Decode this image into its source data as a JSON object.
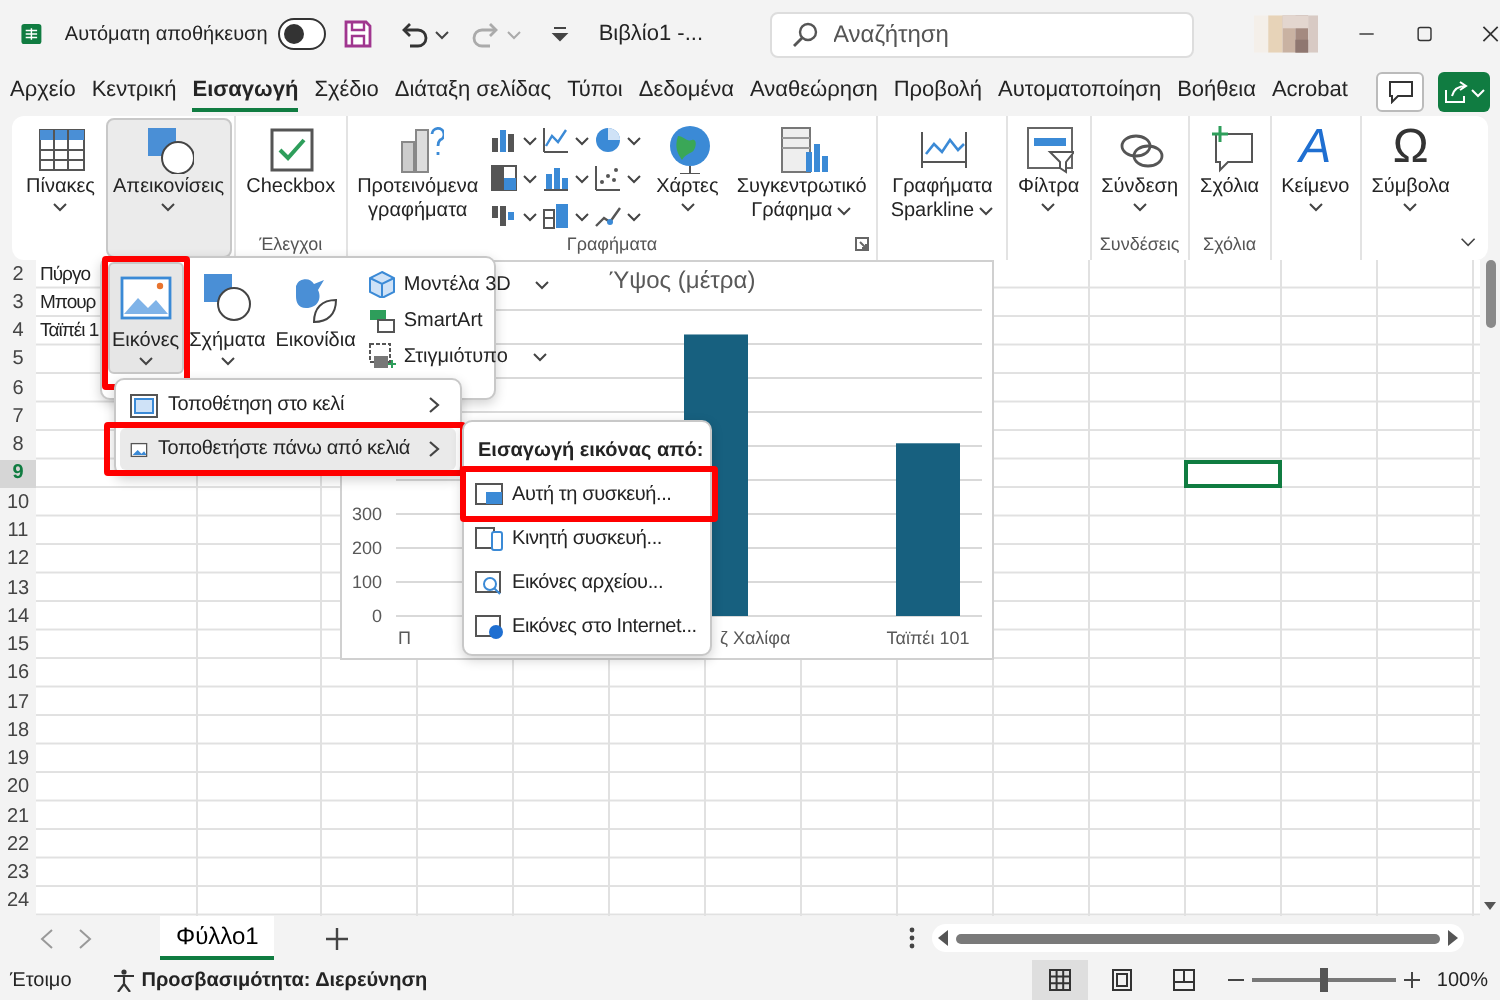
{
  "title_bar": {
    "autosave_label": "Αυτόματη αποθήκευση",
    "autosave_on": false,
    "document_title": "Βιβλίο1 -...",
    "search": {
      "placeholder": "Αναζήτηση"
    }
  },
  "menu_tabs": [
    {
      "label": "Αρχείο",
      "selected": false
    },
    {
      "label": "Κεντρική",
      "selected": false
    },
    {
      "label": "Εισαγωγή",
      "selected": true
    },
    {
      "label": "Σχέδιο",
      "selected": false
    },
    {
      "label": "Διάταξη σελίδας",
      "selected": false
    },
    {
      "label": "Τύποι",
      "selected": false
    },
    {
      "label": "Δεδομένα",
      "selected": false
    },
    {
      "label": "Αναθεώρηση",
      "selected": false
    },
    {
      "label": "Προβολή",
      "selected": false
    },
    {
      "label": "Αυτοματοποίηση",
      "selected": false
    },
    {
      "label": "Βοήθεια",
      "selected": false
    },
    {
      "label": "Acrobat",
      "selected": false
    }
  ],
  "ribbon": {
    "groups": [
      {
        "launcher": false,
        "buttons": [
          {
            "kind": "large",
            "label": "Πίνακες",
            "dropdown": true,
            "pressed": false
          },
          {
            "kind": "large",
            "label": "Απεικονίσεις",
            "dropdown": true,
            "pressed": true
          }
        ]
      },
      {
        "label": "Έλεγχοι",
        "launcher": false,
        "buttons": [
          {
            "kind": "large",
            "label": "Checkbox",
            "dropdown": false,
            "pressed": false
          }
        ]
      },
      {
        "label": "Γραφήματα",
        "launcher": true,
        "buttons": [
          {
            "kind": "large",
            "label": "Προτεινόμενα γραφήματα",
            "dropdown": false,
            "pressed": false
          },
          {
            "kind": "icon_grid"
          },
          {
            "kind": "large",
            "label": "Χάρτες",
            "dropdown": true,
            "pressed": false
          },
          {
            "kind": "large",
            "label": "Συγκεντρωτικό Γράφημα",
            "dropdown": true,
            "pressed": false
          }
        ]
      },
      {
        "launcher": false,
        "buttons": [
          {
            "kind": "large",
            "label": "Γραφήματα Sparkline",
            "dropdown": true,
            "pressed": false
          }
        ]
      },
      {
        "launcher": false,
        "buttons": [
          {
            "kind": "large",
            "label": "Φίλτρα",
            "dropdown": true,
            "pressed": false
          }
        ]
      },
      {
        "label": "Συνδέσεις",
        "launcher": false,
        "buttons": [
          {
            "kind": "large",
            "label": "Σύνδεση",
            "dropdown": true,
            "pressed": false
          }
        ]
      },
      {
        "label": "Σχόλια",
        "launcher": false,
        "buttons": [
          {
            "kind": "large",
            "label": "Σχόλια",
            "dropdown": false,
            "pressed": false
          }
        ]
      },
      {
        "launcher": false,
        "buttons": [
          {
            "kind": "large",
            "label": "Κείμενο",
            "glyph": "A",
            "dropdown": true,
            "pressed": false
          }
        ]
      },
      {
        "launcher": false,
        "buttons": [
          {
            "kind": "large",
            "label": "Σύμβολα",
            "glyph": "Ω",
            "dropdown": true,
            "pressed": false
          }
        ]
      }
    ]
  },
  "illustrations_gallery": {
    "large": [
      {
        "label": "Εικόνες",
        "dropdown": true,
        "pressed": true,
        "highlighted": true
      },
      {
        "label": "Σχήματα",
        "dropdown": true,
        "pressed": false,
        "highlighted": false
      },
      {
        "label": "Εικονίδια",
        "dropdown": false,
        "pressed": false,
        "highlighted": false
      }
    ],
    "small": [
      {
        "label": "Μοντέλα 3D",
        "dropdown": true
      },
      {
        "label": "SmartArt",
        "dropdown": false
      },
      {
        "label": "Στιγμιότυπο",
        "dropdown": true
      }
    ]
  },
  "pictures_menu": {
    "items": [
      {
        "label": "Τοποθέτηση στο κελί",
        "hovered": false,
        "highlighted": false
      },
      {
        "label": "Τοποθετήστε πάνω από κελιά",
        "hovered": true,
        "highlighted": true
      }
    ]
  },
  "insert_from_menu": {
    "heading": "Εισαγωγή εικόνας από:",
    "items": [
      {
        "label": "Αυτή τη συσκευή...",
        "highlighted": true
      },
      {
        "label": "Κινητή συσκευή...",
        "highlighted": false
      },
      {
        "label": "Εικόνες αρχείου...",
        "highlighted": false
      },
      {
        "label": "Εικόνες στο Internet...",
        "highlighted": false
      }
    ]
  },
  "sheet": {
    "rows": [
      {
        "header": "2",
        "text": "Πύργο",
        "selected": false
      },
      {
        "header": "3",
        "text": "Μπουρ",
        "selected": false
      },
      {
        "header": "4",
        "text": "Ταϊπέι 1",
        "selected": false
      },
      {
        "header": "5",
        "selected": false
      },
      {
        "header": "6",
        "selected": false
      },
      {
        "header": "7",
        "selected": false
      },
      {
        "header": "8",
        "selected": false
      },
      {
        "header": "9",
        "selected": true
      },
      {
        "header": "10",
        "selected": false
      },
      {
        "header": "11",
        "selected": false
      },
      {
        "header": "12",
        "selected": false
      },
      {
        "header": "13",
        "selected": false
      },
      {
        "header": "14",
        "selected": false
      },
      {
        "header": "15",
        "selected": false
      },
      {
        "header": "16",
        "selected": false
      },
      {
        "header": "17",
        "selected": false
      },
      {
        "header": "18",
        "selected": false
      },
      {
        "header": "19",
        "selected": false
      },
      {
        "header": "20",
        "selected": false
      },
      {
        "header": "21",
        "selected": false
      },
      {
        "header": "22",
        "selected": false
      },
      {
        "header": "23",
        "selected": false
      },
      {
        "header": "24",
        "selected": false
      }
    ],
    "chart": {
      "chart_data": {
        "type": "bar",
        "title": "Ύψος (μέτρα)",
        "categories": [
          "Π",
          "ζ Χαλίφα",
          "Ταϊπέι 101"
        ],
        "series": [
          {
            "color": "#17607f",
            "values": [
              null,
              828,
              508
            ]
          }
        ],
        "grid": true,
        "ylim": [
          0,
          900
        ],
        "yticks": [
          0,
          100,
          200,
          300
        ]
      }
    }
  },
  "sheet_tabs": [
    {
      "label": "Φύλλο1",
      "selected": true
    }
  ],
  "status_bar": {
    "mode": "Έτοιμο",
    "accessibility": "Προσβασιμότητα: Διερεύνηση",
    "views": [
      {
        "selected": true
      },
      {
        "selected": false
      },
      {
        "selected": false
      }
    ],
    "zoom": {
      "level": 0.5,
      "reading": "100%"
    }
  }
}
